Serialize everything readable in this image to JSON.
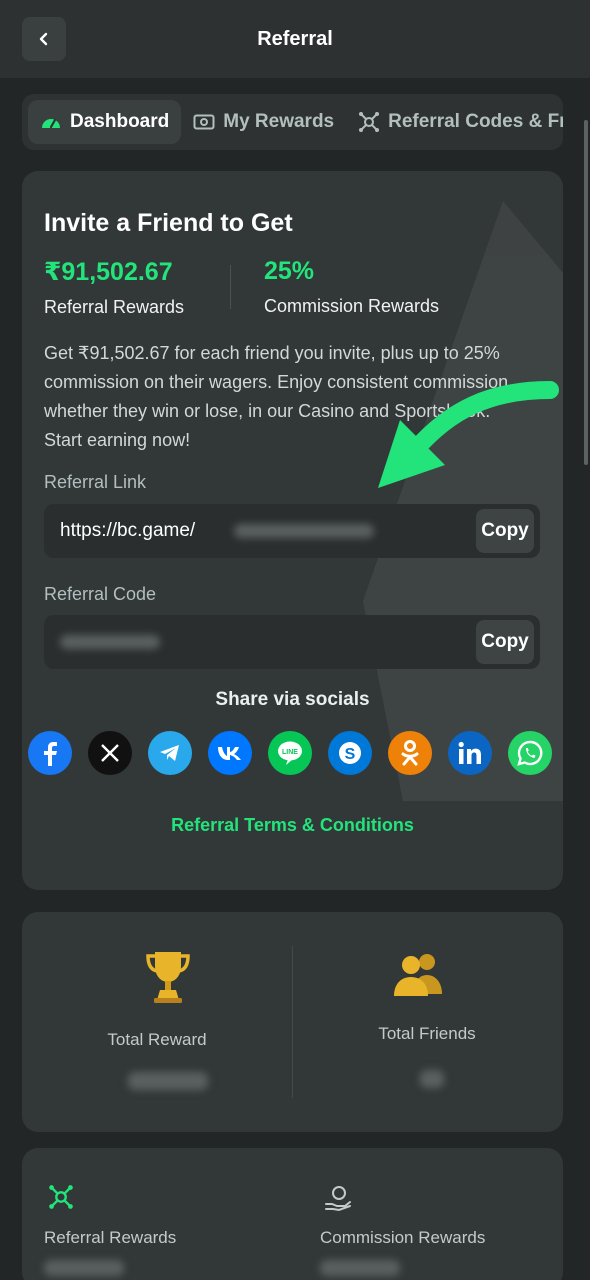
{
  "header": {
    "title": "Referral",
    "back_icon": "chevron-left-icon"
  },
  "tabs": [
    {
      "label": "Dashboard",
      "icon": "dashboard-gauge-icon",
      "active": true
    },
    {
      "label": "My Rewards",
      "icon": "cash-icon",
      "active": false
    },
    {
      "label": "Referral Codes & Fr",
      "icon": "referral-network-icon",
      "active": false
    }
  ],
  "invite": {
    "title": "Invite a Friend to Get",
    "referral_reward_value": "₹91,502.67",
    "referral_reward_label": "Referral Rewards",
    "commission_value": "25%",
    "commission_label": "Commission Rewards",
    "description": "Get ₹91,502.67 for each friend you invite, plus up to 25% commission on their wagers. Enjoy consistent commission, whether they win or lose, in our Casino and Sportsbook. Start earning now!",
    "link_label": "Referral Link",
    "link_value": "https://bc.game/",
    "code_label": "Referral Code",
    "copy_label": "Copy",
    "share_title": "Share via socials",
    "terms_link": "Referral Terms & Conditions"
  },
  "socials": [
    {
      "name": "facebook",
      "color": "#1877f2"
    },
    {
      "name": "x",
      "color": "#111111"
    },
    {
      "name": "telegram",
      "color": "#29a9eb"
    },
    {
      "name": "vk",
      "color": "#0077ff"
    },
    {
      "name": "line",
      "color": "#06c755"
    },
    {
      "name": "skype",
      "color": "#0078d7"
    },
    {
      "name": "odnoklassniki",
      "color": "#ee8208"
    },
    {
      "name": "linkedin",
      "color": "#0a66c2"
    },
    {
      "name": "whatsapp",
      "color": "#25d366"
    }
  ],
  "totals": {
    "total_reward_label": "Total Reward",
    "total_friends_label": "Total Friends",
    "reward_icon": "trophy-icon",
    "friends_icon": "users-icon"
  },
  "rewards": {
    "referral_label": "Referral Rewards",
    "commission_label": "Commission Rewards",
    "referral_icon": "referral-network-icon",
    "commission_icon": "hand-coin-icon"
  },
  "colors": {
    "accent": "#22e47b",
    "background": "#232626",
    "card": "#323738"
  }
}
